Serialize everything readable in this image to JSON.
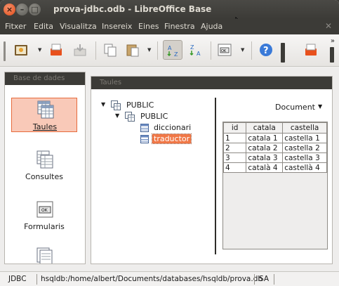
{
  "window": {
    "title": "prova-jdbc.odb - LibreOffice Base"
  },
  "window_buttons": {
    "close": "×",
    "minimize": "–",
    "maximize": "□"
  },
  "menu": {
    "items": [
      "Fitxer",
      "Edita",
      "Visualitza",
      "Insereix",
      "Eines",
      "Finestra",
      "Ajuda"
    ]
  },
  "toolbar": {
    "icons": [
      "open-database-icon",
      "save-icon",
      "copy-icon",
      "paste-icon",
      "sort-ascending-icon",
      "sort-descending-icon",
      "form-icon",
      "help-icon",
      "new-document-icon"
    ],
    "pressed": "sort-ascending-icon"
  },
  "left_panel": {
    "header": "Base de dades",
    "items": [
      {
        "label": "Taules",
        "icon": "table-icon",
        "selected": true
      },
      {
        "label": "Consultes",
        "icon": "query-icon",
        "selected": false
      },
      {
        "label": "Formularis",
        "icon": "form-icon",
        "selected": false
      },
      {
        "label": "",
        "icon": "report-icon",
        "selected": false
      }
    ]
  },
  "right_panel": {
    "header": "Taules",
    "tree": {
      "root": "PUBLIC",
      "schema": "PUBLIC",
      "tables": [
        "diccionari",
        "traductor"
      ],
      "selected": "traductor"
    },
    "preview_mode": "Document",
    "table": {
      "columns": [
        "id",
        "catala",
        "castella"
      ],
      "rows": [
        [
          "1",
          "catala 1",
          "castella 1"
        ],
        [
          "2",
          "catala 2",
          "castella 2"
        ],
        [
          "3",
          "catala 3",
          "castella 3"
        ],
        [
          "4",
          "català 4",
          "castellà 4"
        ]
      ]
    }
  },
  "status": {
    "connection": "JDBC",
    "path": "hsqldb:/home/albert/Documents/databases/hsqldb/prova.db",
    "user": "SA"
  },
  "colors": {
    "accent": "#f07746",
    "selection_bg": "#f9c9b8",
    "titlebar": "#3c3b37"
  }
}
